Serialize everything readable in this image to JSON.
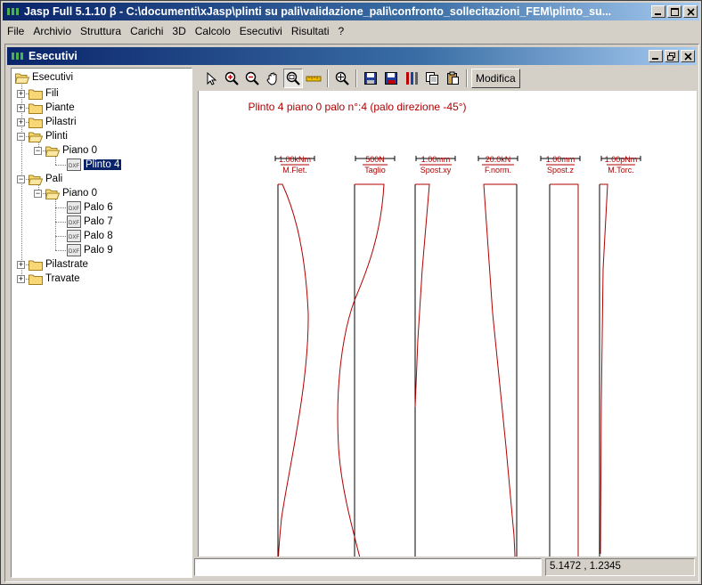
{
  "window": {
    "title": "Jasp Full 5.1.10 β - C:\\documenti\\xJasp\\plinti su pali\\validazione_pali\\confronto_sollecitazioni_FEM\\plinto_su..."
  },
  "menu": [
    "File",
    "Archivio",
    "Struttura",
    "Carichi",
    "3D",
    "Calcolo",
    "Esecutivi",
    "Risultati",
    "?"
  ],
  "child": {
    "title": "Esecutivi"
  },
  "tree": {
    "root": "Esecutivi",
    "fili": "Fili",
    "piante": "Piante",
    "pilastri": "Pilastri",
    "plinti": "Plinti",
    "plinti_piano": "Piano 0",
    "plinto4": "Plinto 4",
    "pali": "Pali",
    "pali_piano": "Piano 0",
    "palo6": "Palo 6",
    "palo7": "Palo 7",
    "palo8": "Palo 8",
    "palo9": "Palo 9",
    "pilastrate": "Pilastrate",
    "travate": "Travate",
    "expand_plus": "+",
    "expand_minus": "−",
    "dxf_label": "DXF"
  },
  "toolbar": {
    "modify_label": "Modifica"
  },
  "plot": {
    "header": "Plinto 4 piano 0 palo n°:4 (palo direzione -45°)",
    "diagrams": [
      {
        "scale": "1.00kNm",
        "name": "M.Flet."
      },
      {
        "scale": "500N",
        "name": "Taglio"
      },
      {
        "scale": "1.00mm",
        "name": "Spost.xy"
      },
      {
        "scale": "20.0kN",
        "name": "F.norm."
      },
      {
        "scale": "1.00mm",
        "name": "Spost.z"
      },
      {
        "scale": "1.00pNm",
        "name": "M.Torc."
      }
    ]
  },
  "status": {
    "coords": "5.1472 , 1.2345"
  },
  "colors": {
    "diagram": "#b00000",
    "titlebar": "#0a246a",
    "selection": "#0a246a"
  }
}
